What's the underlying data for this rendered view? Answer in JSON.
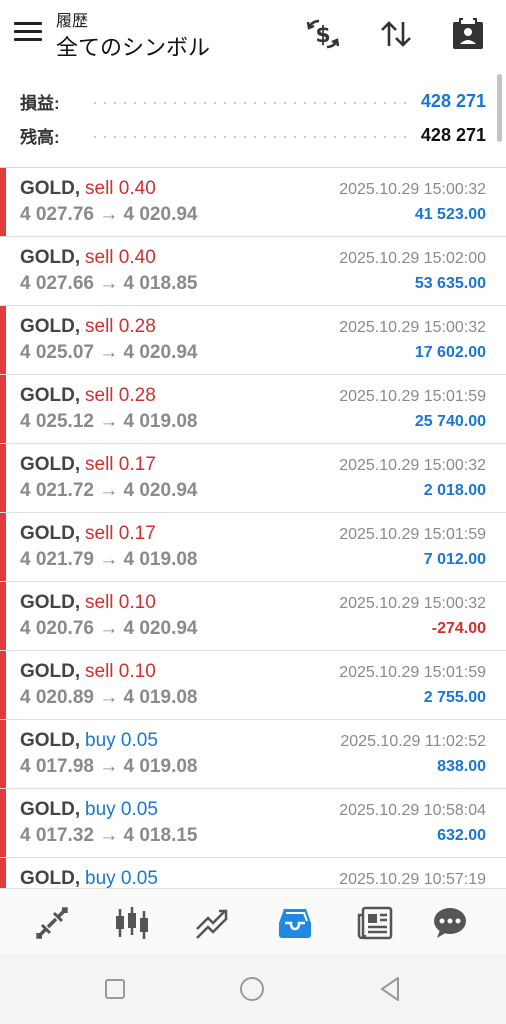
{
  "header": {
    "subtitle": "履歴",
    "title": "全てのシンボル"
  },
  "summary": {
    "profit_label": "損益:",
    "profit_value": "428 271",
    "balance_label": "残高:",
    "balance_value": "428 271"
  },
  "colors": {
    "accent": "#1976d2",
    "sell": "#d32f2f",
    "marker": "#e23b3b",
    "muted": "#8a8a8a"
  },
  "trades": [
    {
      "symbol": "GOLD,",
      "side": "sell",
      "volume": "sell 0.40",
      "prices": "4 027.76 → 4 020.94",
      "time": "2025.10.29 15:00:32",
      "profit": "41 523.00",
      "marker": true
    },
    {
      "symbol": "GOLD,",
      "side": "sell",
      "volume": "sell 0.40",
      "prices": "4 027.66 → 4 018.85",
      "time": "2025.10.29 15:02:00",
      "profit": "53 635.00",
      "marker": false
    },
    {
      "symbol": "GOLD,",
      "side": "sell",
      "volume": "sell 0.28",
      "prices": "4 025.07 → 4 020.94",
      "time": "2025.10.29 15:00:32",
      "profit": "17 602.00",
      "marker": true
    },
    {
      "symbol": "GOLD,",
      "side": "sell",
      "volume": "sell 0.28",
      "prices": "4 025.12 → 4 019.08",
      "time": "2025.10.29 15:01:59",
      "profit": "25 740.00",
      "marker": true
    },
    {
      "symbol": "GOLD,",
      "side": "sell",
      "volume": "sell 0.17",
      "prices": "4 021.72 → 4 020.94",
      "time": "2025.10.29 15:00:32",
      "profit": "2 018.00",
      "marker": true
    },
    {
      "symbol": "GOLD,",
      "side": "sell",
      "volume": "sell 0.17",
      "prices": "4 021.79 → 4 019.08",
      "time": "2025.10.29 15:01:59",
      "profit": "7 012.00",
      "marker": true
    },
    {
      "symbol": "GOLD,",
      "side": "sell",
      "volume": "sell 0.10",
      "prices": "4 020.76 → 4 020.94",
      "time": "2025.10.29 15:00:32",
      "profit": "-274.00",
      "marker": true
    },
    {
      "symbol": "GOLD,",
      "side": "sell",
      "volume": "sell 0.10",
      "prices": "4 020.89 → 4 019.08",
      "time": "2025.10.29 15:01:59",
      "profit": "2 755.00",
      "marker": true
    },
    {
      "symbol": "GOLD,",
      "side": "buy",
      "volume": "buy 0.05",
      "prices": "4 017.98 → 4 019.08",
      "time": "2025.10.29 11:02:52",
      "profit": "838.00",
      "marker": true
    },
    {
      "symbol": "GOLD,",
      "side": "buy",
      "volume": "buy 0.05",
      "prices": "4 017.32 → 4 018.15",
      "time": "2025.10.29 10:58:04",
      "profit": "632.00",
      "marker": true
    },
    {
      "symbol": "GOLD,",
      "side": "buy",
      "volume": "buy 0.05",
      "prices": "",
      "time": "2025.10.29 10:57:19",
      "profit": "",
      "marker": true
    }
  ],
  "nav": [
    {
      "icon": "quotes-icon",
      "active": false
    },
    {
      "icon": "chart-icon",
      "active": false
    },
    {
      "icon": "trade-icon",
      "active": false
    },
    {
      "icon": "history-icon",
      "active": true
    },
    {
      "icon": "news-icon",
      "active": false
    },
    {
      "icon": "chat-icon",
      "active": false
    }
  ]
}
